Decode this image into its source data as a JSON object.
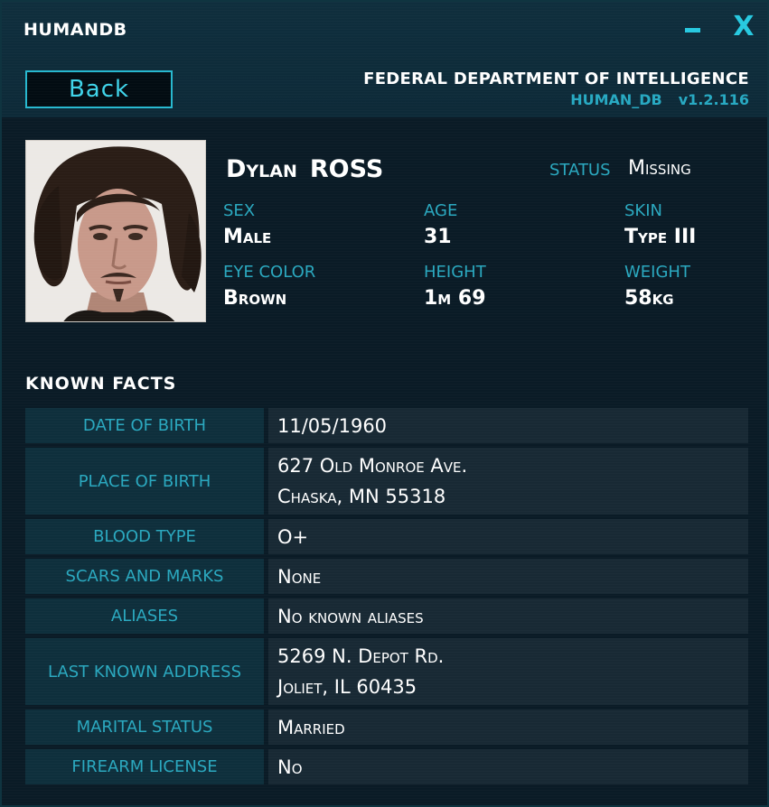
{
  "window": {
    "title": "HUMANDB",
    "minimize_icon": "minimize-icon",
    "close_label": "X"
  },
  "header": {
    "back_label": "Back",
    "agency": "FEDERAL DEPARTMENT OF INTELLIGENCE",
    "db_name": "HUMAN_DB",
    "version": "v1.2.116"
  },
  "profile": {
    "first_name": "Dylan",
    "last_name": "ROSS",
    "status_label": "STATUS",
    "status_value": "Missing",
    "sex_label": "SEX",
    "sex_value": "Male",
    "age_label": "AGE",
    "age_value": "31",
    "skin_label": "SKIN",
    "skin_value": "Type III",
    "eye_label": "EYE COLOR",
    "eye_value": "Brown",
    "height_label": "HEIGHT",
    "height_value": "1m 69",
    "weight_label": "WEIGHT",
    "weight_value": "58kg"
  },
  "facts": {
    "title": "KNOWN FACTS",
    "rows": [
      {
        "label": "DATE OF BIRTH",
        "lines": [
          "11/05/1960"
        ]
      },
      {
        "label": "PLACE OF BIRTH",
        "lines": [
          "627 Old Monroe Ave.",
          "Chaska, MN 55318"
        ]
      },
      {
        "label": "BLOOD TYPE",
        "lines": [
          "O+"
        ]
      },
      {
        "label": "SCARS AND MARKS",
        "lines": [
          "None"
        ]
      },
      {
        "label": "ALIASES",
        "lines": [
          "No known aliases"
        ]
      },
      {
        "label": "LAST KNOWN ADDRESS",
        "lines": [
          "5269 N. Depot Rd.",
          "Joliet, IL 60435"
        ]
      },
      {
        "label": "MARITAL STATUS",
        "lines": [
          "Married"
        ]
      },
      {
        "label": "FIREARM LICENSE",
        "lines": [
          "No"
        ]
      }
    ]
  },
  "colors": {
    "accent": "#27c9e0",
    "label": "#2aa8bf",
    "panel_label_bg": "#0e2f3c",
    "panel_value_bg": "#182934",
    "window_bg": "#0a1b26"
  }
}
